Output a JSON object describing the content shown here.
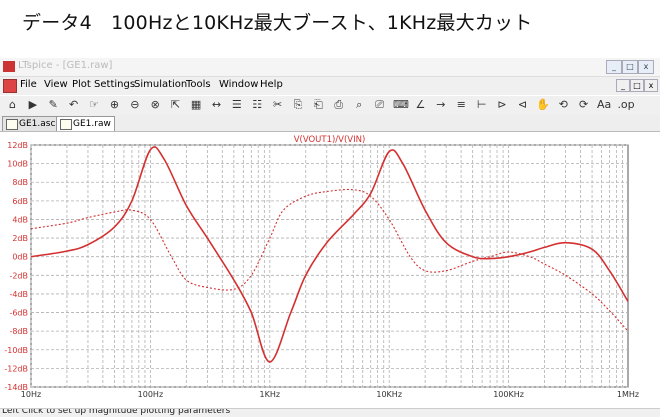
{
  "slide": {
    "title": "データ4　100Hzと10KHz最大ブースト、1KHz最大カット"
  },
  "window": {
    "title_partial": "LTspice - [GE1.raw]",
    "controls": [
      "_",
      "□",
      "x"
    ]
  },
  "menu": {
    "items": [
      "File",
      "View",
      "Plot Settings",
      "Simulation",
      "Tools",
      "Window",
      "Help"
    ]
  },
  "toolbar": {
    "buttons": [
      "⌂",
      "▶",
      "✎",
      "↶",
      "☞",
      "⊕",
      "⊖",
      "⊗",
      "⇱",
      "▦",
      "↔",
      "☰",
      "☷",
      "✂",
      "⎘",
      "⎗",
      "⎙",
      "⌕",
      "⎚",
      "⌨",
      "∠",
      "→",
      "≡",
      "⊢",
      "⊳",
      "⊲",
      "✋",
      "⟲",
      "⟳",
      "Aa",
      ".op"
    ]
  },
  "tabs": [
    {
      "label": "GE1.asc",
      "active": false
    },
    {
      "label": "GE1.raw",
      "active": true
    }
  ],
  "status": {
    "text": "Left Click to set up magnitude plotting parameters"
  },
  "colors": {
    "trace": "#d43030",
    "grid": "#b0b0b0",
    "axis_text": "#d43030",
    "slide_text": "#111111"
  },
  "chart_data": {
    "type": "line",
    "title": "V(VOUT1)/V(VIN)",
    "x_scale": "log",
    "xlim": [
      10,
      1000000
    ],
    "x_ticks": [
      {
        "value": 10,
        "label": "10Hz"
      },
      {
        "value": 100,
        "label": "100Hz"
      },
      {
        "value": 1000,
        "label": "1KHz"
      },
      {
        "value": 10000,
        "label": "10KHz"
      },
      {
        "value": 100000,
        "label": "100KHz"
      },
      {
        "value": 1000000,
        "label": "1MHz"
      }
    ],
    "ylim": [
      -14,
      12
    ],
    "y_ticks": [
      "12dB",
      "10dB",
      "8dB",
      "6dB",
      "4dB",
      "2dB",
      "0dB",
      "-2dB",
      "-4dB",
      "-6dB",
      "-8dB",
      "-10dB",
      "-12dB",
      "-14dB"
    ],
    "right_ticks": [
      "",
      "",
      "",
      "",
      "",
      "",
      "",
      "",
      "",
      "",
      "",
      "",
      "",
      ""
    ],
    "series": [
      {
        "style": "solid",
        "x": [
          10,
          20,
          30,
          50,
          70,
          100,
          130,
          200,
          300,
          500,
          700,
          1000,
          1500,
          2000,
          3000,
          5000,
          7000,
          10000,
          13000,
          20000,
          30000,
          50000,
          70000,
          100000,
          150000,
          200000,
          300000,
          500000,
          700000,
          1000000
        ],
        "y": [
          0,
          0.6,
          1.3,
          3.2,
          6.0,
          11.5,
          10.5,
          5.5,
          2.0,
          -2.5,
          -6.0,
          -11.3,
          -6.0,
          -2.0,
          1.5,
          4.5,
          6.8,
          11.3,
          10.0,
          5.0,
          1.5,
          0,
          -0.2,
          0,
          0.5,
          1.0,
          1.5,
          0.8,
          -1.5,
          -4.8
        ]
      },
      {
        "style": "dotted",
        "x": [
          10,
          20,
          30,
          50,
          70,
          100,
          150,
          200,
          300,
          500,
          700,
          1000,
          1300,
          2000,
          3000,
          5000,
          7000,
          10000,
          15000,
          20000,
          30000,
          50000,
          70000,
          100000,
          150000,
          200000,
          300000,
          500000,
          700000,
          1000000
        ],
        "y": [
          3,
          3.6,
          4.2,
          4.8,
          5.0,
          4.0,
          0,
          -2.5,
          -3.3,
          -3.5,
          -2.0,
          2.0,
          5.0,
          6.5,
          7.0,
          7.2,
          6.5,
          4.0,
          0,
          -1.5,
          -1.5,
          -0.5,
          0,
          0.5,
          0,
          -0.8,
          -2.0,
          -4.0,
          -5.8,
          -8.0
        ]
      }
    ]
  }
}
